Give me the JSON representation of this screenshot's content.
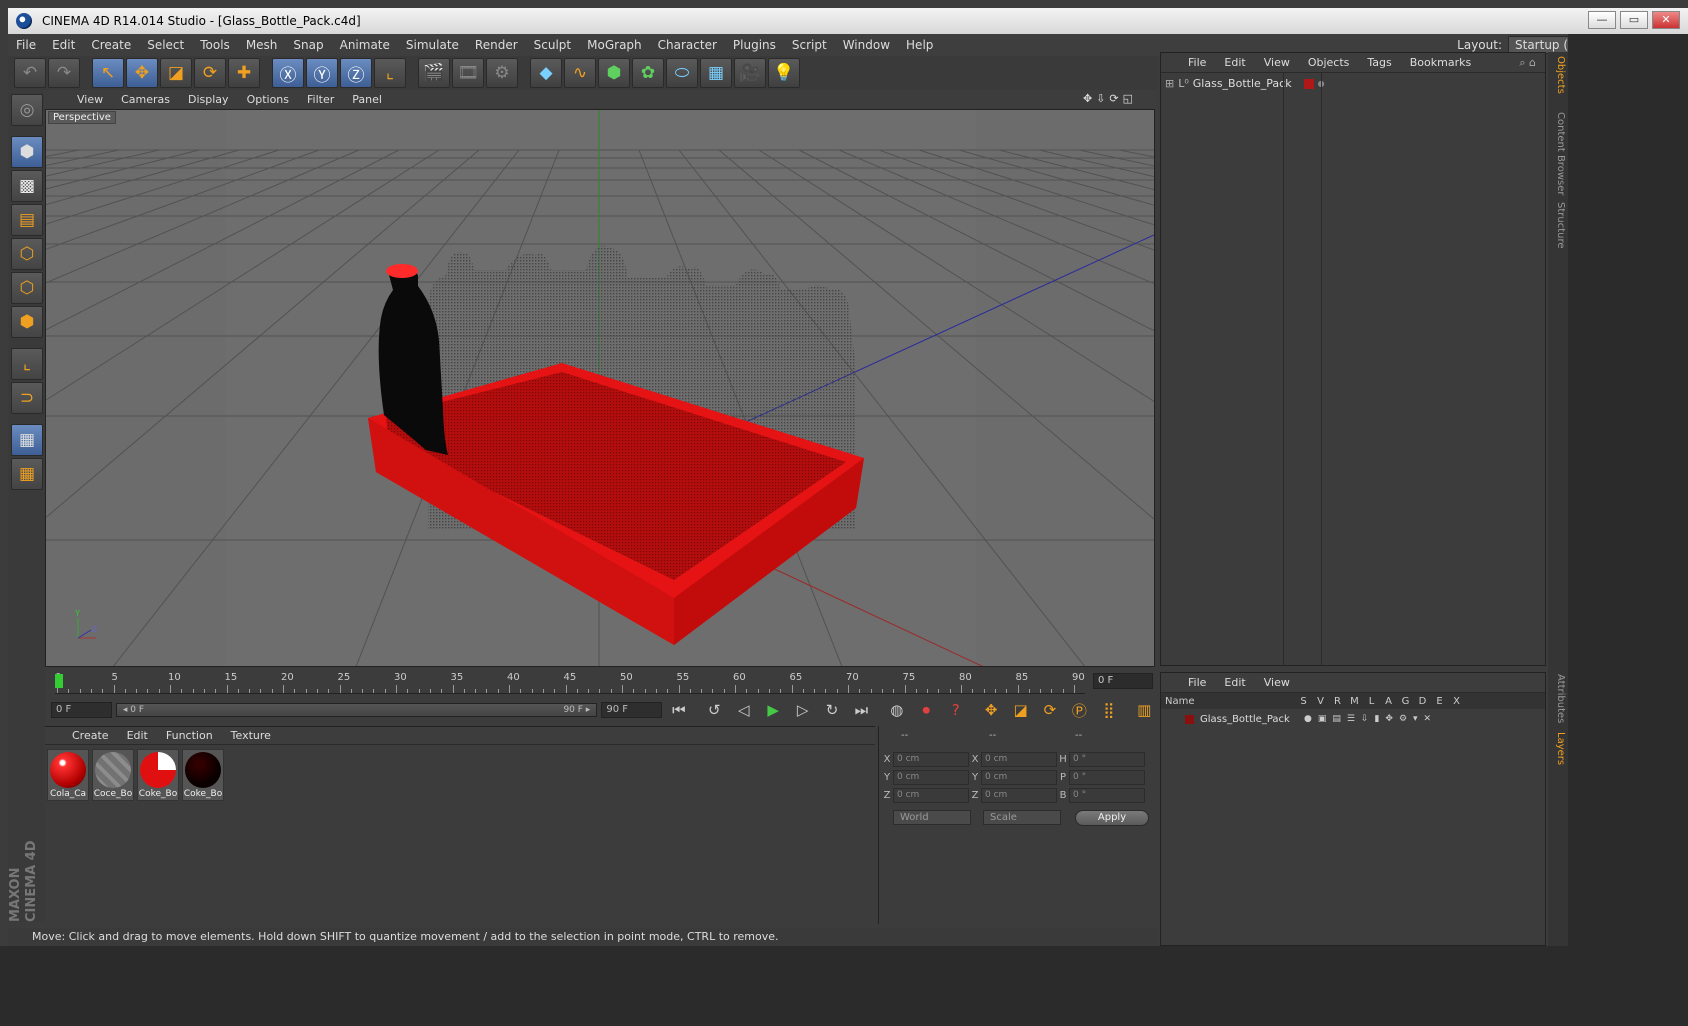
{
  "window": {
    "title": "CINEMA 4D R14.014 Studio - [Glass_Bottle_Pack.c4d]",
    "min": "—",
    "max": "▭",
    "close": "✕"
  },
  "menu": [
    "File",
    "Edit",
    "Create",
    "Select",
    "Tools",
    "Mesh",
    "Snap",
    "Animate",
    "Simulate",
    "Render",
    "Sculpt",
    "MoGraph",
    "Character",
    "Plugins",
    "Script",
    "Window",
    "Help"
  ],
  "layout": {
    "label": "Layout:",
    "value": "Startup (User)"
  },
  "viewport": {
    "menu": [
      "View",
      "Cameras",
      "Display",
      "Options",
      "Filter",
      "Panel"
    ],
    "label": "Perspective",
    "icons": "✥⇩⟳◱"
  },
  "timeline": {
    "ticks": [
      "0",
      "5",
      "10",
      "15",
      "20",
      "25",
      "30",
      "35",
      "40",
      "45",
      "50",
      "55",
      "60",
      "65",
      "70",
      "75",
      "80",
      "85",
      "90"
    ],
    "frame": "0 F"
  },
  "playback": {
    "start": "0 F",
    "slider_start": "◂ 0 F",
    "slider_end": "90 F ▸",
    "end": "90 F"
  },
  "materials": {
    "menu": [
      "Create",
      "Edit",
      "Function",
      "Texture"
    ],
    "items": [
      {
        "label": "Cola_Ca",
        "color": "#e01818",
        "type": "glossy"
      },
      {
        "label": "Coce_Bo",
        "color": "#888888",
        "type": "glass"
      },
      {
        "label": "Coke_Bo",
        "color": "#e01818",
        "type": "labeled"
      },
      {
        "label": "Coke_Bo",
        "color": "#0a0000",
        "type": "dark"
      }
    ]
  },
  "coords": {
    "headers": [
      "--",
      "--",
      "--"
    ],
    "rows": [
      [
        "X",
        "0 cm",
        "X",
        "0 cm",
        "H",
        "0 °"
      ],
      [
        "Y",
        "0 cm",
        "Y",
        "0 cm",
        "P",
        "0 °"
      ],
      [
        "Z",
        "0 cm",
        "Z",
        "0 cm",
        "B",
        "0 °"
      ]
    ],
    "mode1": "World",
    "mode2": "Scale",
    "apply": "Apply"
  },
  "objects": {
    "menu": [
      "File",
      "Edit",
      "View",
      "Objects",
      "Tags",
      "Bookmarks"
    ],
    "name": "Glass_Bottle_Pack",
    "layer_color": "#b01818"
  },
  "layers": {
    "menu": [
      "File",
      "Edit",
      "View"
    ],
    "headers": [
      "Name",
      "S",
      "V",
      "R",
      "M",
      "L",
      "A",
      "G",
      "D",
      "E",
      "X"
    ],
    "name": "Glass_Bottle_Pack"
  },
  "sidetabs": [
    "Objects",
    "Content Browser",
    "Structure",
    "Attributes",
    "Layers"
  ],
  "status": "Move: Click and drag to move elements. Hold down SHIFT to quantize movement / add to the selection in point mode, CTRL to remove.",
  "brand": {
    "line1": "MAXON",
    "line2": "CINEMA 4D"
  }
}
